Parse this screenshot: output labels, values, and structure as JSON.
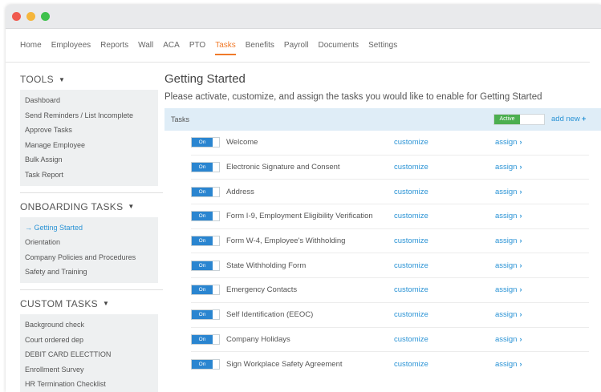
{
  "window": {
    "dots": [
      {
        "name": "close-dot",
        "color": "#f05a4f"
      },
      {
        "name": "minimize-dot",
        "color": "#f5b63c"
      },
      {
        "name": "maximize-dot",
        "color": "#3fc14c"
      }
    ]
  },
  "nav": {
    "items": [
      "Home",
      "Employees",
      "Reports",
      "Wall",
      "ACA",
      "PTO",
      "Tasks",
      "Benefits",
      "Payroll",
      "Documents",
      "Settings"
    ],
    "active": "Tasks",
    "accent_color": "#f07a2a"
  },
  "sidebar": {
    "tools": {
      "title": "TOOLS",
      "items": [
        "Dashboard",
        "Send Reminders / List Incomplete",
        "Approve Tasks",
        "Manage Employee",
        "Bulk Assign",
        "Task Report"
      ]
    },
    "onboarding": {
      "title": "ONBOARDING TASKS",
      "items": [
        "Getting Started",
        "Orientation",
        "Company Policies and Procedures",
        "Safety and Training"
      ],
      "active_item": "Getting Started",
      "active_prefix": "→"
    },
    "custom": {
      "title": "CUSTOM TASKS",
      "items": [
        "Background check",
        "Court ordered dep",
        "DEBIT CARD ELECTTION",
        "Enrollment Survey",
        "HR Termination Checklist"
      ]
    },
    "caret": "▼"
  },
  "main": {
    "title": "Getting Started",
    "subtitle": "Please activate, customize, and assign the tasks you would like to enable for Getting Started",
    "tasks_label": "Tasks",
    "active_label": "Active",
    "add_new_label": "add new",
    "add_new_icon": "+",
    "toggle_on_label": "On",
    "customize_label": "customize",
    "assign_label": "assign",
    "assign_icon": "›",
    "tasks": [
      "Welcome",
      "Electronic Signature and Consent",
      "Address",
      "Form I-9, Employment Eligibility Verification",
      "Form W-4, Employee's Withholding",
      "State Withholding Form",
      "Emergency Contacts",
      "Self Identification (EEOC)",
      "Company Holidays",
      "Sign Workplace Safety Agreement"
    ],
    "link_color": "#2a93d5",
    "toggle_color": "#2a85d0",
    "active_color": "#4caf50"
  }
}
